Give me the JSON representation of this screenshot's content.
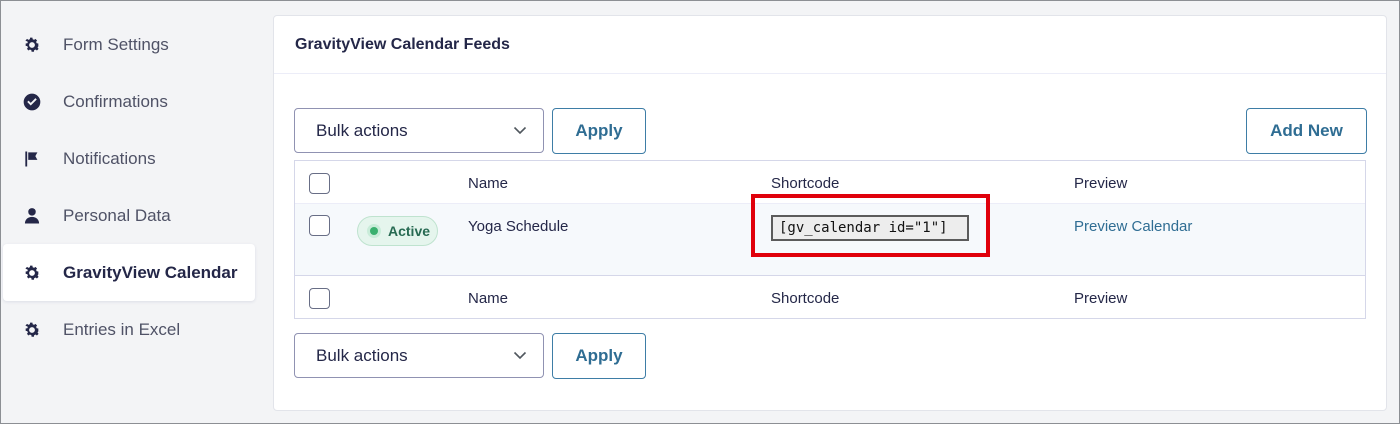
{
  "sidebar": {
    "items": [
      {
        "label": "Form Settings",
        "icon": "gear-icon",
        "active": false
      },
      {
        "label": "Confirmations",
        "icon": "check-circle-icon",
        "active": false
      },
      {
        "label": "Notifications",
        "icon": "flag-icon",
        "active": false
      },
      {
        "label": "Personal Data",
        "icon": "user-icon",
        "active": false
      },
      {
        "label": "GravityView Calendar",
        "icon": "gear-icon",
        "active": true
      },
      {
        "label": "Entries in Excel",
        "icon": "gear-icon",
        "active": false
      }
    ]
  },
  "panel": {
    "title": "GravityView Calendar Feeds",
    "bulk_top": {
      "select_value": "Bulk actions",
      "apply_label": "Apply"
    },
    "add_new_label": "Add New",
    "bulk_bottom": {
      "select_value": "Bulk actions",
      "apply_label": "Apply"
    },
    "table": {
      "columns": {
        "name": "Name",
        "shortcode": "Shortcode",
        "preview": "Preview"
      },
      "rows": [
        {
          "status": "Active",
          "name": "Yoga Schedule",
          "shortcode": "[gv_calendar id=\"1\"]",
          "preview_link": "Preview Calendar"
        }
      ]
    }
  },
  "colors": {
    "accent": "#2f6d93",
    "status_active": "#3ab06f",
    "highlight": "#e0000b"
  }
}
